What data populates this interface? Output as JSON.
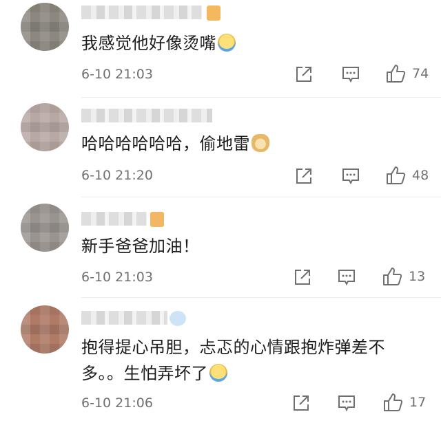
{
  "comments": [
    {
      "text": "我感觉他好像烫嘴",
      "emoji": "laugh-cry-emoji",
      "time": "6-10 21:03",
      "likes": "74"
    },
    {
      "text": "哈哈哈哈哈哈，偷地雷",
      "emoji": "doge-emoji",
      "time": "6-10 21:20",
      "likes": "48"
    },
    {
      "text": "新手爸爸加油！",
      "emoji": "",
      "time": "6-10 21:03",
      "likes": "13"
    },
    {
      "text": "抱得提心吊胆，忐忑的心情跟抱炸弹差不多。。生怕弄坏了",
      "emoji": "laugh-cry-emoji",
      "time": "6-10 21:06",
      "likes": "17"
    }
  ],
  "icons": {
    "share": "share-icon",
    "reply": "comment-icon",
    "like": "thumbs-up-icon"
  },
  "colors": {
    "meta_text": "#6f6f6f",
    "icon": "#6f6f6f",
    "background": "#ffffff"
  }
}
